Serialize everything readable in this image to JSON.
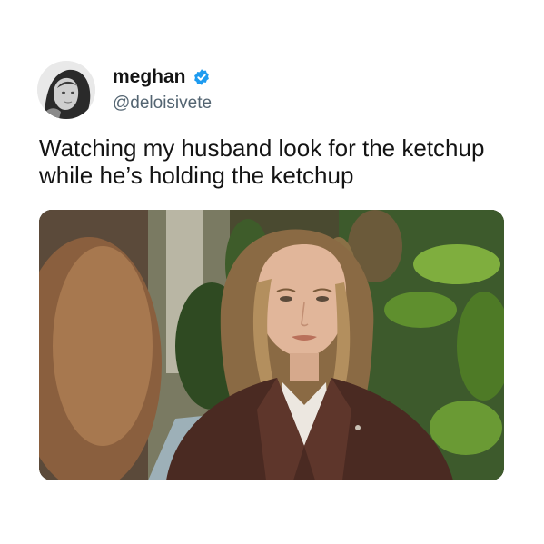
{
  "post": {
    "author": {
      "display_name": "meghan",
      "handle": "@deloisivete",
      "verified": true,
      "verified_color": "#1d9bf0",
      "avatar_icon": "profile-photo-avatar"
    },
    "text_lines": [
      "Watching my husband look for the ketchup",
      "while he’s holding the ketchup"
    ],
    "media": {
      "type": "photo",
      "icon": "photo-still-woman-in-leather-jacket"
    }
  },
  "colors": {
    "background": "#ffffff",
    "text": "#141414",
    "handle": "#536471",
    "verified_badge": "#1d9bf0"
  }
}
